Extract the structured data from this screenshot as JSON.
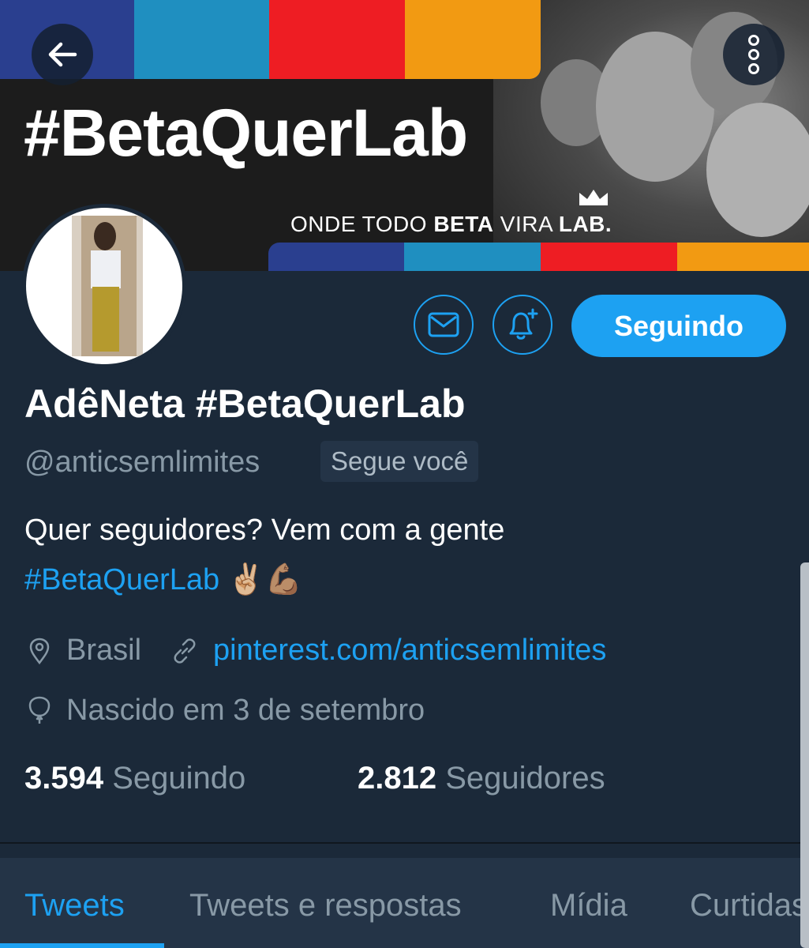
{
  "banner": {
    "hashtag": "#BetaQuerLab",
    "tagline_part1": "ONDE TODO ",
    "tagline_bold1": "BETA",
    "tagline_part2": " VIRA ",
    "tagline_bold2": "LAB."
  },
  "header": {
    "back_icon": "arrow-left-icon",
    "more_icon": "more-vertical-icon"
  },
  "actions": {
    "message_icon": "envelope-icon",
    "notify_icon": "bell-plus-icon",
    "follow_label": "Seguindo"
  },
  "profile": {
    "name": "AdêNeta #BetaQuerLab",
    "handle": "@anticsemlimites",
    "follows_you": "Segue você",
    "bio_line1": "Quer seguidores? Vem com a gente",
    "bio_hashtag": "#BetaQuerLab",
    "bio_emoji": "✌🏼💪🏽",
    "location": "Brasil",
    "website": "pinterest.com/anticsemlimites",
    "birthday": "Nascido em 3 de setembro"
  },
  "stats": {
    "following_count": "3.594",
    "following_label": "Seguindo",
    "followers_count": "2.812",
    "followers_label": "Seguidores"
  },
  "tabs": [
    {
      "label": "Tweets"
    },
    {
      "label": "Tweets e respostas"
    },
    {
      "label": "Mídia"
    },
    {
      "label": "Curtidas"
    }
  ],
  "colors": {
    "accent": "#1da1f2",
    "background": "#1b2939",
    "muted_text": "#8899a6"
  }
}
